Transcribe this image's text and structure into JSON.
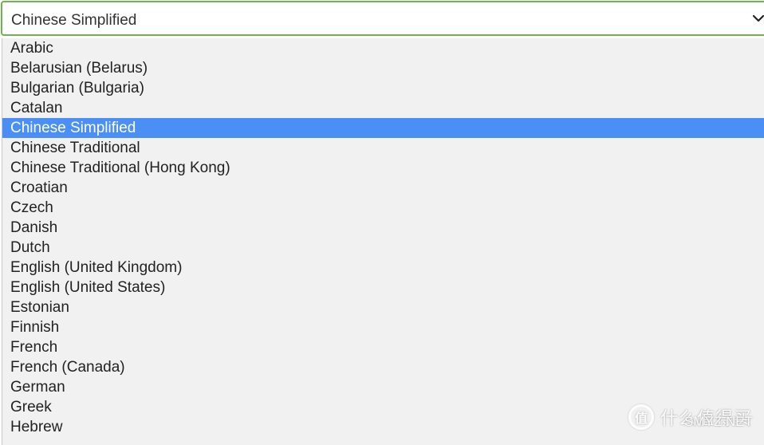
{
  "select": {
    "value": "Chinese Simplified",
    "chevron_icon": "chevron-down-icon",
    "border_color": "#6cb54a"
  },
  "options": [
    {
      "label": "Arabic"
    },
    {
      "label": "Belarusian (Belarus)"
    },
    {
      "label": "Bulgarian (Bulgaria)"
    },
    {
      "label": "Catalan"
    },
    {
      "label": "Chinese Simplified",
      "selected": true
    },
    {
      "label": "Chinese Traditional"
    },
    {
      "label": "Chinese Traditional (Hong Kong)"
    },
    {
      "label": "Croatian"
    },
    {
      "label": "Czech"
    },
    {
      "label": "Danish"
    },
    {
      "label": "Dutch"
    },
    {
      "label": "English (United Kingdom)"
    },
    {
      "label": "English (United States)"
    },
    {
      "label": "Estonian"
    },
    {
      "label": "Finnish"
    },
    {
      "label": "French"
    },
    {
      "label": "French (Canada)"
    },
    {
      "label": "German"
    },
    {
      "label": "Greek"
    },
    {
      "label": "Hebrew"
    }
  ],
  "highlight_color": "#4a8ff6",
  "watermark": {
    "logo_char": "值",
    "text": "什么值得买",
    "sub": "SMYZ.NET"
  }
}
